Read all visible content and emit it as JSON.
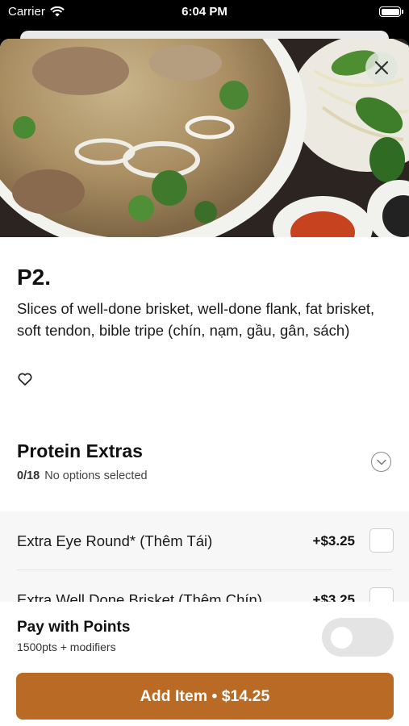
{
  "status_bar": {
    "carrier": "Carrier",
    "time": "6:04 PM"
  },
  "item": {
    "title": "P2.",
    "description": "Slices of well-done brisket, well-done flank, fat brisket, soft tendon, bible tripe (chín, nạm, gầu, gân, sách)",
    "favorite_icon": "heart-outline-icon"
  },
  "modifier_group": {
    "title": "Protein Extras",
    "count": "0/18",
    "status": "No options selected",
    "chevron_icon": "chevron-down-circle-icon"
  },
  "options": [
    {
      "label": "Extra Eye Round* (Thêm Tái)",
      "price": "+$3.25",
      "checked": false
    },
    {
      "label": "Extra Well Done Brisket (Thêm Chín)",
      "price": "+$3.25",
      "checked": false
    }
  ],
  "footer": {
    "points_title": "Pay with Points",
    "points_subtitle": "1500pts + modifiers",
    "points_enabled": false,
    "add_button_label": "Add Item • $14.25"
  },
  "colors": {
    "accent": "#b96a24",
    "toggle_off": "#e4e4e4",
    "options_background": "#f7f7f7"
  }
}
